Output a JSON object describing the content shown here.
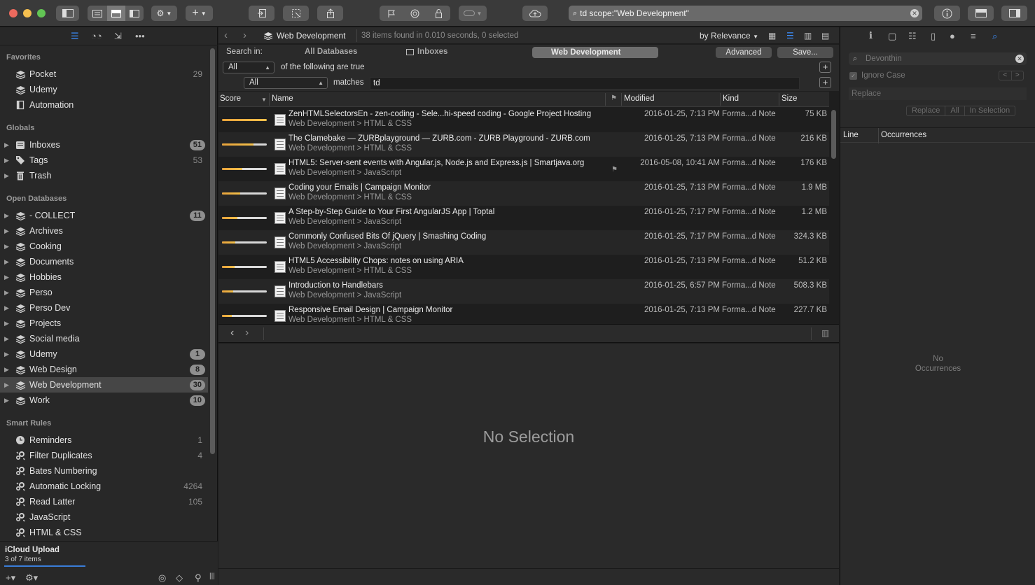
{
  "toolbar": {
    "search_query": "td scope:\"Web Development\""
  },
  "sidebar": {
    "sections": {
      "favorites": "Favorites",
      "globals": "Globals",
      "open_databases": "Open Databases",
      "smart_rules": "Smart Rules"
    },
    "favorites": [
      {
        "label": "Pocket",
        "count": "29",
        "icon": "database-icon"
      },
      {
        "label": "Udemy",
        "count": "",
        "icon": "database-icon"
      },
      {
        "label": "Automation",
        "count": "",
        "icon": "document-icon"
      }
    ],
    "globals": [
      {
        "label": "Inboxes",
        "badge": "51"
      },
      {
        "label": "Tags",
        "count": "53"
      },
      {
        "label": "Trash",
        "count": ""
      }
    ],
    "databases": [
      {
        "label": "- COLLECT",
        "badge": "11"
      },
      {
        "label": "Archives",
        "badge": ""
      },
      {
        "label": "Cooking",
        "badge": ""
      },
      {
        "label": "Documents",
        "badge": ""
      },
      {
        "label": "Hobbies",
        "badge": ""
      },
      {
        "label": "Perso",
        "badge": ""
      },
      {
        "label": "Perso Dev",
        "badge": ""
      },
      {
        "label": "Projects",
        "badge": ""
      },
      {
        "label": "Social media",
        "badge": ""
      },
      {
        "label": "Udemy",
        "badge": "1"
      },
      {
        "label": "Web Design",
        "badge": "8"
      },
      {
        "label": "Web Development",
        "badge": "30",
        "selected": true
      },
      {
        "label": "Work",
        "badge": "10"
      }
    ],
    "smart_rules": [
      {
        "label": "Reminders",
        "count": "1"
      },
      {
        "label": "Filter Duplicates",
        "count": "4"
      },
      {
        "label": "Bates Numbering",
        "count": ""
      },
      {
        "label": "Automatic Locking",
        "count": "4264"
      },
      {
        "label": "Read Latter",
        "count": "105"
      },
      {
        "label": "JavaScript",
        "count": ""
      },
      {
        "label": "HTML & CSS",
        "count": ""
      }
    ],
    "upload": {
      "title": "iCloud Upload",
      "subtitle": "3 of 7 items",
      "progress": 0.43
    }
  },
  "navbar": {
    "breadcrumb": "Web Development",
    "found": "38 items found in 0.010 seconds, 0 selected",
    "sort": "by Relevance"
  },
  "scope": {
    "label": "Search in:",
    "all_databases": "All Databases",
    "inboxes": "Inboxes",
    "web_development": "Web Development",
    "advanced": "Advanced",
    "save": "Save..."
  },
  "criteria": {
    "row1_popup": "All",
    "row1_text": "of the following are true",
    "row2_popup": "All",
    "row2_op": "matches",
    "row2_value": "td"
  },
  "table": {
    "headers": {
      "score": "Score",
      "name": "Name",
      "modified": "Modified",
      "kind": "Kind",
      "size": "Size"
    },
    "rows": [
      {
        "score": 1.0,
        "name": "ZenHTMLSelectorsEn - zen-coding - Sele...hi-speed coding - Google Project Hosting",
        "location": "Web Development > HTML & CSS",
        "modified": "2016-01-25, 7:13 PM",
        "kind": "Forma...d Note",
        "size": "75 KB",
        "flag": false
      },
      {
        "score": 0.7,
        "name": "The Clamebake — ZURBplayground — ZURB.com - ZURB Playground - ZURB.com",
        "location": "Web Development > HTML & CSS",
        "modified": "2016-01-25, 7:13 PM",
        "kind": "Forma...d Note",
        "size": "216 KB",
        "flag": false
      },
      {
        "score": 0.45,
        "name": "HTML5: Server-sent events with Angular.js, Node.js and Express.js | Smartjava.org",
        "location": "Web Development > JavaScript",
        "modified": "2016-05-08, 10:41 AM",
        "kind": "Forma...d Note",
        "size": "176 KB",
        "flag": true
      },
      {
        "score": 0.4,
        "name": "Coding your Emails | Campaign Monitor",
        "location": "Web Development > HTML & CSS",
        "modified": "2016-01-25, 7:13 PM",
        "kind": "Forma...d Note",
        "size": "1.9 MB",
        "flag": false
      },
      {
        "score": 0.35,
        "name": "A Step-by-Step Guide to Your First AngularJS App | Toptal",
        "location": "Web Development > JavaScript",
        "modified": "2016-01-25, 7:17 PM",
        "kind": "Forma...d Note",
        "size": "1.2 MB",
        "flag": false
      },
      {
        "score": 0.3,
        "name": "Commonly Confused Bits Of jQuery | Smashing Coding",
        "location": "Web Development > JavaScript",
        "modified": "2016-01-25, 7:17 PM",
        "kind": "Forma...d Note",
        "size": "324.3 KB",
        "flag": false
      },
      {
        "score": 0.28,
        "name": "HTML5 Accessibility Chops: notes on using ARIA",
        "location": "Web Development > HTML & CSS",
        "modified": "2016-01-25, 7:13 PM",
        "kind": "Forma...d Note",
        "size": "51.2 KB",
        "flag": false
      },
      {
        "score": 0.25,
        "name": "Introduction to Handlebars",
        "location": "Web Development > JavaScript",
        "modified": "2016-01-25, 6:57 PM",
        "kind": "Forma...d Note",
        "size": "508.3 KB",
        "flag": false
      },
      {
        "score": 0.22,
        "name": "Responsive Email Design | Campaign Monitor",
        "location": "Web Development > HTML & CSS",
        "modified": "2016-01-25, 7:13 PM",
        "kind": "Forma...d Note",
        "size": "227.7 KB",
        "flag": false
      }
    ]
  },
  "viewer": {
    "empty": "No Selection"
  },
  "inspector": {
    "find_placeholder": "Devonthin",
    "ignore_case": "Ignore Case",
    "replace_placeholder": "Replace",
    "replace_buttons": [
      "Replace",
      "All",
      "In Selection"
    ],
    "col_line": "Line",
    "col_occurrences": "Occurrences",
    "empty_line1": "No",
    "empty_line2": "Occurrences"
  },
  "colors": {
    "accent": "#3b8fff",
    "selection": "#464646"
  }
}
